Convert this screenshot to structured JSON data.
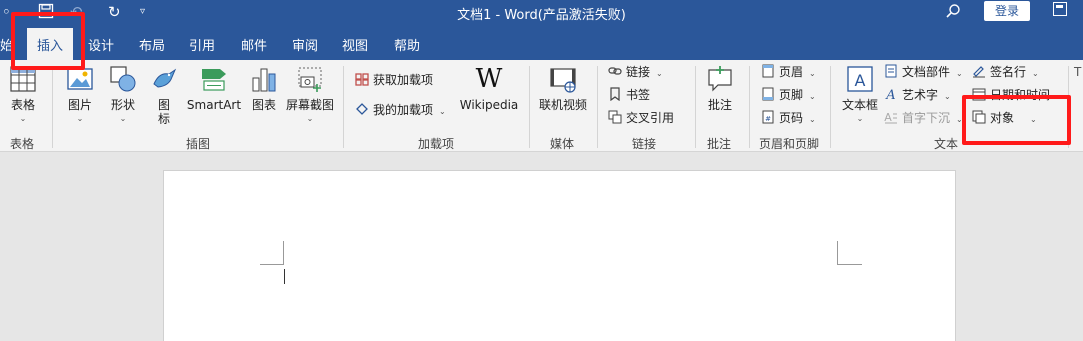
{
  "titlebar": {
    "doc_title": "文档1 - Word(产品激活失败)",
    "sign_in": "登录",
    "icons": [
      "save-icon",
      "undo-icon",
      "redo-icon",
      "customize-quick-access-icon",
      "search-icon",
      "ribbon-display-icon"
    ]
  },
  "tabs": [
    {
      "label": "始"
    },
    {
      "label": "插入"
    },
    {
      "label": "设计"
    },
    {
      "label": "布局"
    },
    {
      "label": "引用"
    },
    {
      "label": "邮件"
    },
    {
      "label": "审阅"
    },
    {
      "label": "视图"
    },
    {
      "label": "帮助"
    }
  ],
  "ribbon": {
    "table_group": {
      "label": "表格",
      "button": "表格"
    },
    "illustrations": {
      "label": "插图",
      "picture": "图片",
      "shapes": "形状",
      "icons_line1": "图",
      "icons_line2": "标",
      "smartart": "SmartArt",
      "chart": "图表",
      "screenshot": "屏幕截图"
    },
    "addins": {
      "label": "加载项",
      "get": "获取加载项",
      "my": "我的加载项",
      "wiki": "Wikipedia",
      "wiki_logo": "W"
    },
    "media": {
      "label": "媒体",
      "video": "联机视频"
    },
    "links": {
      "label": "链接",
      "link": "链接",
      "bookmark": "书签",
      "crossref": "交叉引用"
    },
    "comments": {
      "label": "批注",
      "comment": "批注"
    },
    "header_footer": {
      "label": "页眉和页脚",
      "header": "页眉",
      "footer": "页脚",
      "page_number": "页码"
    },
    "text": {
      "label": "文本",
      "textbox_line1": "文本框",
      "quick_parts": "文档部件",
      "wordart": "艺术字",
      "dropcap": "首字下沉",
      "signature_line": "签名行",
      "date_time": "日期和时间",
      "object": "对象"
    }
  },
  "colors": {
    "accent": "#2b579a",
    "highlight": "#ff1a1a"
  }
}
